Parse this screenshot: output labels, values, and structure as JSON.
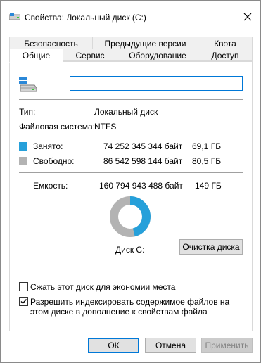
{
  "window": {
    "title": "Свойства: Локальный диск (C:)"
  },
  "tabs_row1": [
    {
      "label": "Безопасность"
    },
    {
      "label": "Предыдущие версии"
    },
    {
      "label": "Квота"
    }
  ],
  "tabs_row2": [
    {
      "label": "Общие",
      "active": true
    },
    {
      "label": "Сервис"
    },
    {
      "label": "Оборудование"
    },
    {
      "label": "Доступ"
    }
  ],
  "general": {
    "drive_name_value": "",
    "type_label": "Тип:",
    "type_value": "Локальный диск",
    "fs_label": "Файловая система:",
    "fs_value": "NTFS",
    "used": {
      "label": "Занято:",
      "bytes": "74 252 345 344 байт",
      "size": "69,1 ГБ",
      "color": "#26a0da"
    },
    "free": {
      "label": "Свободно:",
      "bytes": "86 542 598 144 байт",
      "size": "80,5 ГБ",
      "color": "#b3b3b3"
    },
    "capacity": {
      "label": "Емкость:",
      "bytes": "160 794 943 488 байт",
      "size": "149 ГБ"
    },
    "used_fraction": 0.462,
    "disk_label": "Диск C:",
    "cleanup_button": "Очистка диска",
    "compress_checkbox": {
      "label": "Сжать этот диск для экономии места",
      "checked": false
    },
    "index_checkbox": {
      "label": "Разрешить индексировать содержимое файлов на этом диске в дополнение к свойствам файла",
      "checked": true
    }
  },
  "buttons": {
    "ok": "ОК",
    "cancel": "Отмена",
    "apply": "Применить"
  }
}
